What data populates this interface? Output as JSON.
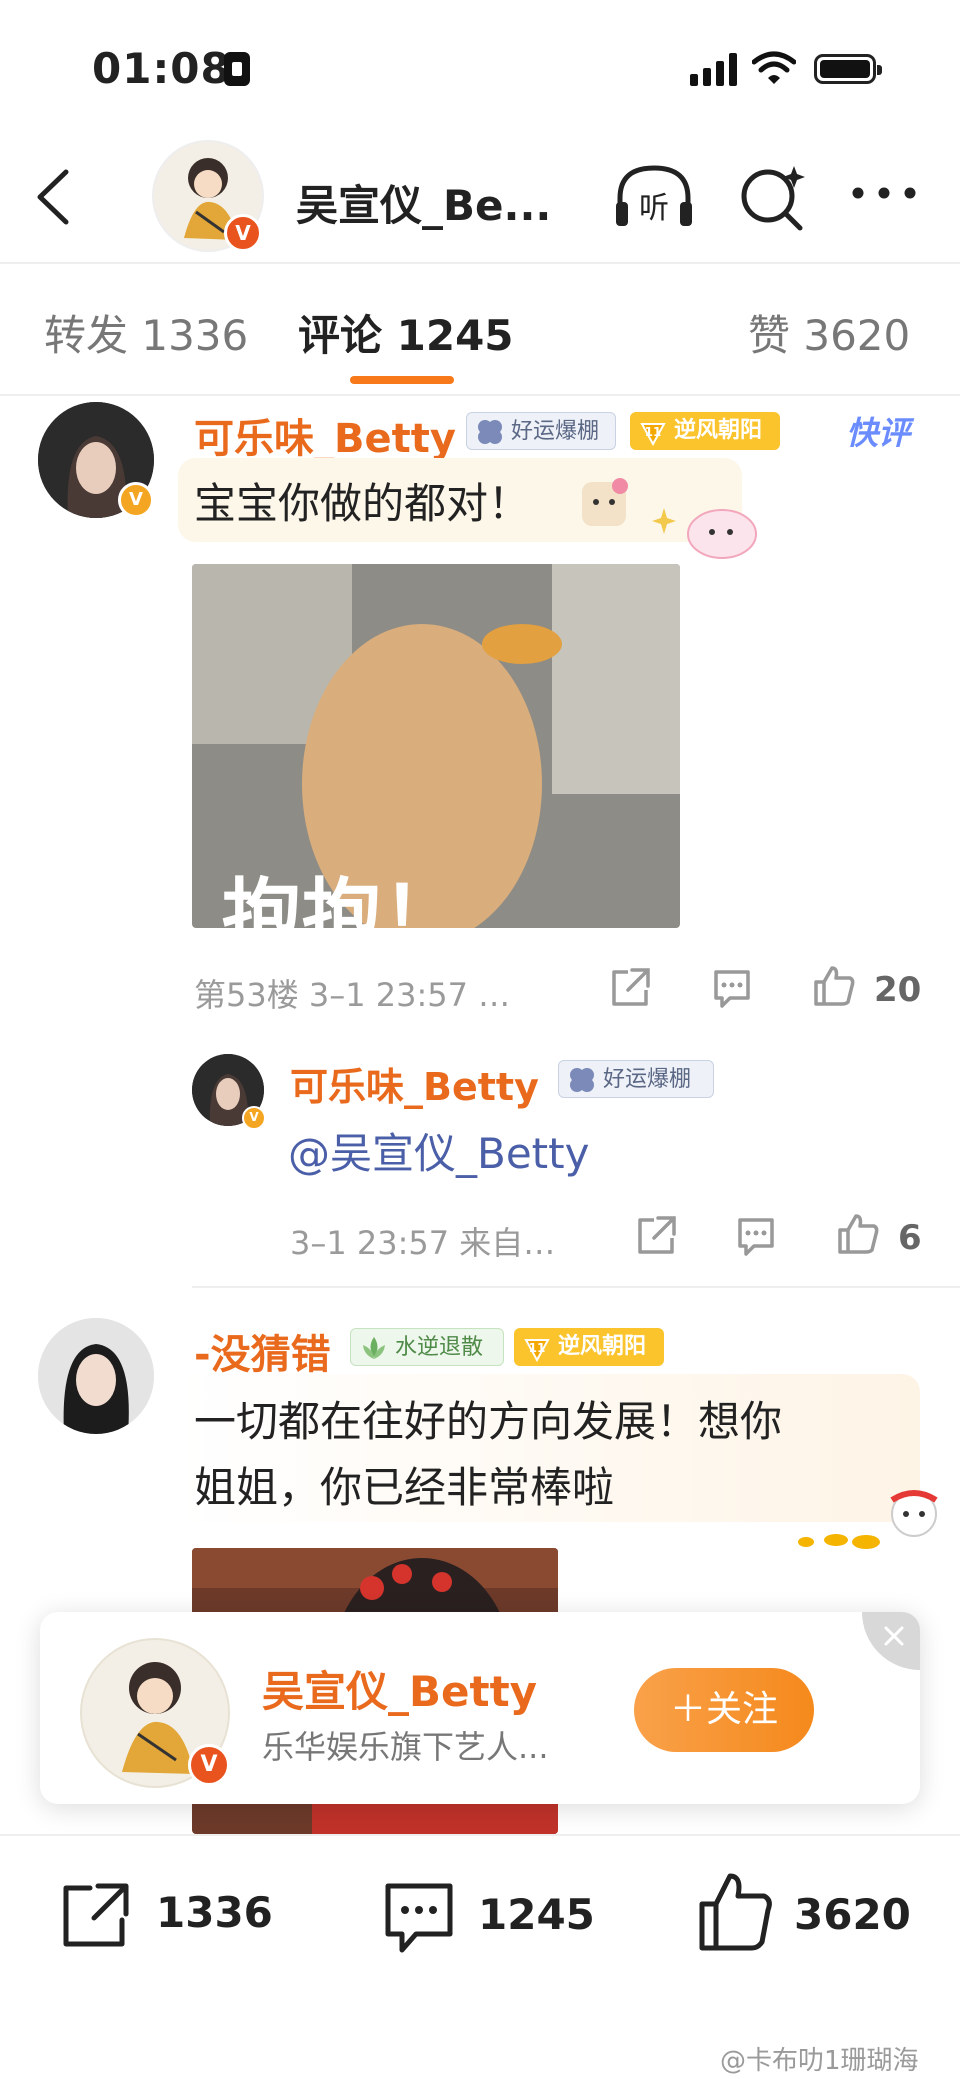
{
  "status_bar": {
    "time": "01:08"
  },
  "header": {
    "title": "吴宣仪_Be..."
  },
  "tabs": [
    {
      "label": "转发 1336"
    },
    {
      "label": "评论 1245"
    },
    {
      "label": "赞 3620"
    }
  ],
  "comments": [
    {
      "username": "可乐味_Betty",
      "badges": [
        "好运爆棚",
        "逆风朝阳"
      ],
      "badge_level": "11",
      "quick_tag": "快评",
      "text": "宝宝你做的都对！",
      "image_caption": "抱抱！",
      "meta": "第53楼 3–1 23:57 …",
      "likes": "20",
      "reply": {
        "username": "可乐味_Betty",
        "badge": "好运爆棚",
        "text": "@吴宣仪_Betty",
        "meta": "3–1 23:57 来自…",
        "likes": "6"
      }
    },
    {
      "username": "-没猜错",
      "badges": [
        "水逆退散",
        "逆风朝阳"
      ],
      "badge_level": "11",
      "text_line1": "一切都在往好的方向发展！想你",
      "text_line2": "姐姐，你已经非常棒啦"
    }
  ],
  "follow_card": {
    "name": "吴宣仪_Betty",
    "desc": "乐华娱乐旗下艺人...",
    "button": "＋关注"
  },
  "bottom_bar": {
    "repost": "1336",
    "comment": "1245",
    "like": "3620"
  },
  "watermark": "@卡布叻1珊瑚海",
  "colors": {
    "accent": "#f7791a",
    "username": "#e96a1d",
    "mention": "#4a5fa8"
  }
}
